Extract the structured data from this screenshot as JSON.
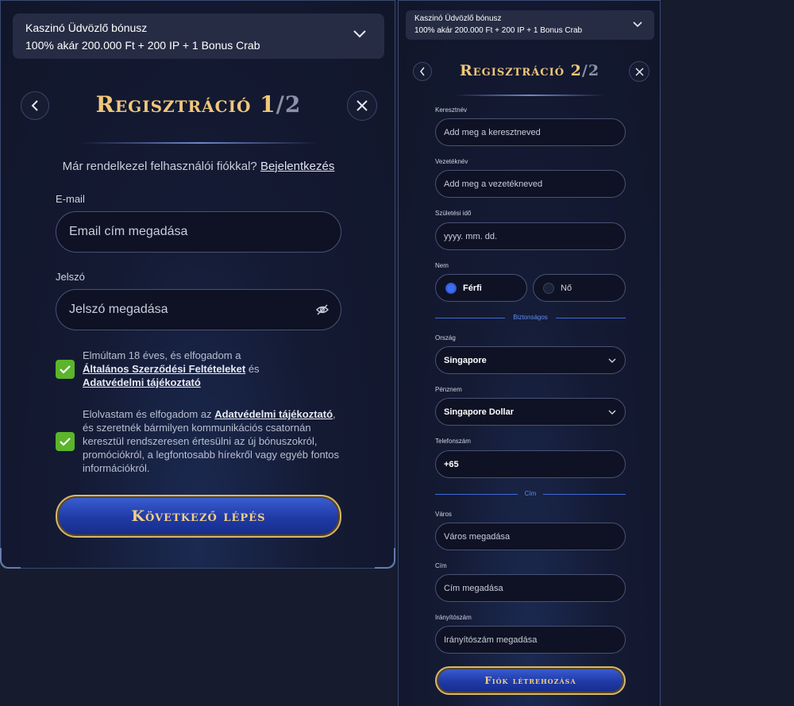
{
  "panel1": {
    "bonus": {
      "title": "Kaszinó Üdvözlő bónusz",
      "subtitle": "100% akár 200.000 Ft + 200 IP + 1 Bonus Crab",
      "icon": "chevron-down-icon"
    },
    "title": {
      "main": "Regisztráció 1",
      "sep": "/2"
    },
    "login_prompt": "Már rendelkezel felhasználói fiókkal?",
    "login_link": "Bejelentkezés",
    "email_label": "E-mail",
    "email_placeholder": "Email cím megadása",
    "password_label": "Jelszó",
    "password_placeholder": "Jelszó megadása",
    "consent1": {
      "a": "Elmúltam 18 éves, és elfogadom a",
      "link1": "Általános Szerződési Feltételeket",
      "b": "és",
      "link2": "Adatvédelmi tájékoztató",
      "checked": true
    },
    "consent2": {
      "a": "Elolvastam és elfogadom az",
      "link": "Adatvédelmi tájékoztató",
      "b": ", és szeretnék bármilyen kommunikációs csatornán keresztül rendszeresen értesülni az új bónuszokról, promóciókról, a legfontosabb hírekről vagy egyéb fontos információkról.",
      "checked": true
    },
    "next_button": "Következő lépés"
  },
  "panel2": {
    "bonus": {
      "title": "Kaszinó Üdvözlő bónusz",
      "subtitle": "100% akár 200.000 Ft + 200 IP + 1 Bonus Crab"
    },
    "title": {
      "main": "Regisztráció 2",
      "sep": "/2"
    },
    "first_name": {
      "label": "Keresztnév",
      "placeholder": "Add meg a keresztneved"
    },
    "last_name": {
      "label": "Vezetéknév",
      "placeholder": "Add meg a vezetékneved"
    },
    "birth": {
      "label": "Születési idő",
      "placeholder": "yyyy. mm. dd."
    },
    "gender": {
      "label": "Nem",
      "options": [
        "Férfi",
        "Nő"
      ],
      "selected": "Férfi"
    },
    "secure_sep": "Biztonságos",
    "country": {
      "label": "Ország",
      "value": "Singapore"
    },
    "currency": {
      "label": "Pénznem",
      "value": "Singapore Dollar"
    },
    "phone": {
      "label": "Telefonszám",
      "value": "+65"
    },
    "address_sep": "Cím",
    "city": {
      "label": "Város",
      "placeholder": "Város megadása"
    },
    "address": {
      "label": "Cím",
      "placeholder": "Cím megadása"
    },
    "zip": {
      "label": "Irányítószám",
      "placeholder": "Irányítószám megadása"
    },
    "create_button": "Fiók létrehozása"
  },
  "colors": {
    "accent_gold": "#f0c77a",
    "checkbox_green": "#5bb42a",
    "button_blue": "#1f3aa6",
    "separator_blue": "#3f69d8"
  }
}
